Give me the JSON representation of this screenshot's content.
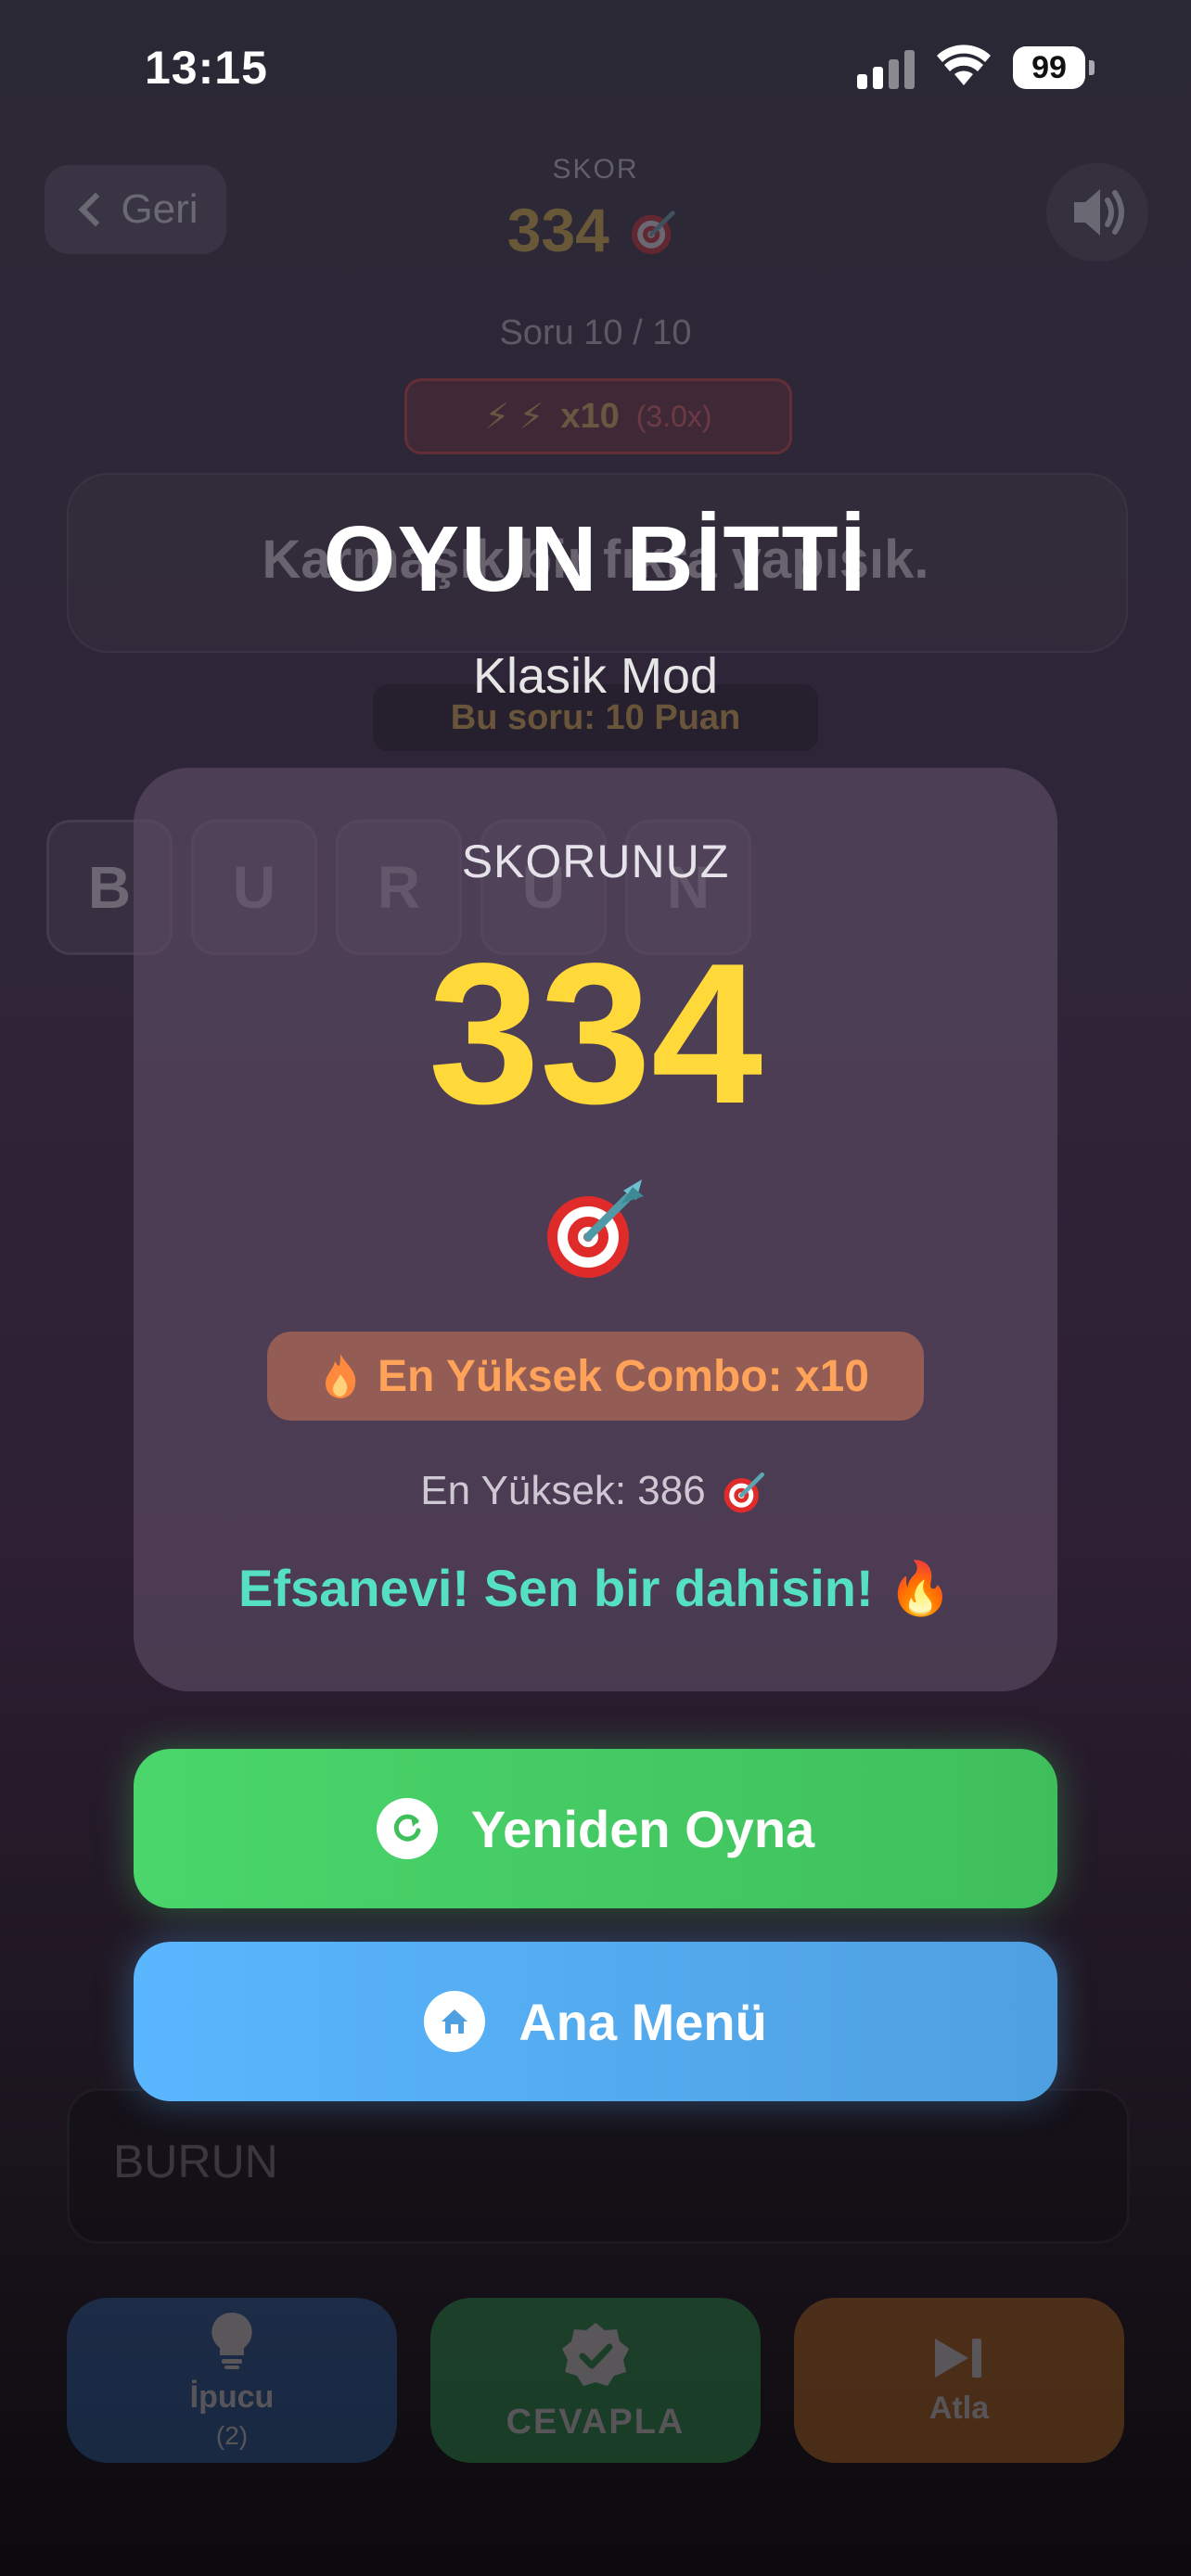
{
  "status_bar": {
    "time": "13:15",
    "battery": "99"
  },
  "header": {
    "back_label": "Geri",
    "score_label": "SKOR",
    "score_value": "334"
  },
  "game": {
    "question_counter": "Soru 10 / 10",
    "combo": {
      "count": "x10",
      "multiplier": "(3.0x)"
    },
    "question_text": "Karmaşık bir fıkra yapışık.",
    "points_label": "Bu soru: 10 Puan",
    "letters": [
      "B",
      "U",
      "R",
      "U",
      "N"
    ],
    "answer_value": "BURUN",
    "actions": [
      {
        "label": "İpucu",
        "sub": "(2)"
      },
      {
        "label": "CEVAPLA"
      },
      {
        "label": "Atla"
      }
    ]
  },
  "modal": {
    "title": "OYUN BİTTİ",
    "mode": "Klasik Mod",
    "score_label": "SKORUNUZ",
    "score": "334",
    "combo_badge": "En Yüksek Combo: x10",
    "best_score": "En Yüksek: 386",
    "praise": "Efsanevi! Sen bir dahisin!",
    "play_again_label": "Yeniden Oyna",
    "main_menu_label": "Ana Menü"
  },
  "colors": {
    "score_yellow": "#ffd83a",
    "combo_orange": "#ffa25a",
    "praise_teal": "#55e0c2",
    "play_again_green": "#4ad66b",
    "main_menu_blue": "#5ab6ff"
  },
  "icons": {
    "dart": "dart-target-icon",
    "flame": "flame-icon",
    "fire": "fire-emoji-icon",
    "refresh": "refresh-icon",
    "home": "home-icon",
    "speaker": "speaker-icon",
    "hint": "lightbulb-icon",
    "check": "check-badge-icon",
    "skip": "skip-icon"
  }
}
